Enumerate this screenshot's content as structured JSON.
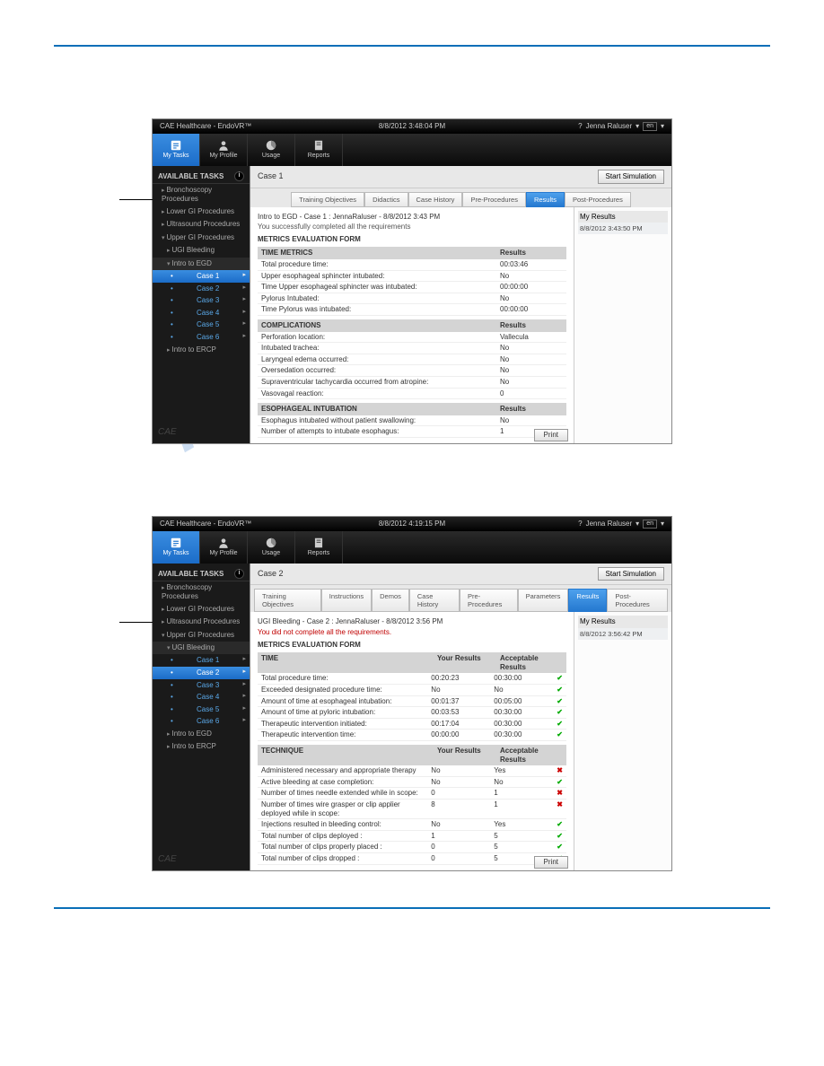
{
  "watermark": "manualshive.com",
  "shot1": {
    "titlebar": {
      "app": "CAE Healthcare - EndoVR™",
      "time": "8/8/2012 3:48:04 PM",
      "user": "Jenna Raluser",
      "lang": "en"
    },
    "toolbar": [
      {
        "label": "My Tasks",
        "active": true
      },
      {
        "label": "My Profile",
        "active": false
      },
      {
        "label": "Usage",
        "active": false
      },
      {
        "label": "Reports",
        "active": false
      }
    ],
    "sidebar": {
      "header": "AVAILABLE TASKS",
      "items": [
        {
          "label": "Bronchoscopy Procedures",
          "type": "cat"
        },
        {
          "label": "Lower GI Procedures",
          "type": "cat"
        },
        {
          "label": "Ultrasound Procedures",
          "type": "cat"
        },
        {
          "label": "Upper GI Procedures",
          "type": "cat-exp"
        },
        {
          "label": "UGI Bleeding",
          "type": "sub-cat"
        },
        {
          "label": "Intro to EGD",
          "type": "sub-cat-exp"
        },
        {
          "label": "Case 1",
          "type": "case",
          "active": true
        },
        {
          "label": "Case 2",
          "type": "case"
        },
        {
          "label": "Case 3",
          "type": "case"
        },
        {
          "label": "Case 4",
          "type": "case"
        },
        {
          "label": "Case 5",
          "type": "case"
        },
        {
          "label": "Case 6",
          "type": "case"
        },
        {
          "label": "Intro to ERCP",
          "type": "sub-cat"
        }
      ]
    },
    "content": {
      "title": "Case 1",
      "startsim": "Start Simulation",
      "tabs": [
        "Training Objectives",
        "Didactics",
        "Case History",
        "Pre-Procedures",
        "Results",
        "Post-Procedures"
      ],
      "active_tab": "Results",
      "case_line": "Intro to EGD - Case 1 : JennaRaluser - 8/8/2012 3:43 PM",
      "status": "You successfully completed all the requirements",
      "status_ok": true,
      "form_title": "METRICS EVALUATION FORM",
      "sections": [
        {
          "head": {
            "title": "TIME METRICS",
            "col2": "Results"
          },
          "rows": [
            [
              "Total procedure time:",
              "00:03:46"
            ],
            [
              "Upper esophageal sphincter intubated:",
              "No"
            ],
            [
              "Time Upper esophageal sphincter was intubated:",
              "00:00:00"
            ],
            [
              "Pylorus Intubated:",
              "No"
            ],
            [
              "Time Pylorus was intubated:",
              "00:00:00"
            ]
          ]
        },
        {
          "head": {
            "title": "COMPLICATIONS",
            "col2": "Results"
          },
          "rows": [
            [
              "Perforation location:",
              "Vallecula"
            ],
            [
              "Intubated trachea:",
              "No"
            ],
            [
              "Laryngeal edema occurred:",
              "No"
            ],
            [
              "Oversedation occurred:",
              "No"
            ],
            [
              "Supraventricular tachycardia occurred from atropine:",
              "No"
            ],
            [
              "Vasovagal reaction:",
              "0"
            ]
          ]
        },
        {
          "head": {
            "title": "ESOPHAGEAL INTUBATION",
            "col2": "Results"
          },
          "rows": [
            [
              "Esophagus intubated without patient swallowing:",
              "No"
            ],
            [
              "Number of attempts to intubate esophagus:",
              "1"
            ]
          ]
        }
      ],
      "print": "Print",
      "rightpanel": {
        "title": "My Results",
        "ts": "8/8/2012 3:43:50 PM"
      }
    }
  },
  "shot2": {
    "titlebar": {
      "app": "CAE Healthcare - EndoVR™",
      "time": "8/8/2012 4:19:15 PM",
      "user": "Jenna Raluser",
      "lang": "en"
    },
    "toolbar": [
      {
        "label": "My Tasks",
        "active": true
      },
      {
        "label": "My Profile",
        "active": false
      },
      {
        "label": "Usage",
        "active": false
      },
      {
        "label": "Reports",
        "active": false
      }
    ],
    "sidebar": {
      "header": "AVAILABLE TASKS",
      "items": [
        {
          "label": "Bronchoscopy Procedures",
          "type": "cat"
        },
        {
          "label": "Lower GI Procedures",
          "type": "cat"
        },
        {
          "label": "Ultrasound Procedures",
          "type": "cat"
        },
        {
          "label": "Upper GI Procedures",
          "type": "cat-exp"
        },
        {
          "label": "UGI Bleeding",
          "type": "sub-cat-exp"
        },
        {
          "label": "Case 1",
          "type": "case"
        },
        {
          "label": "Case 2",
          "type": "case",
          "active": true
        },
        {
          "label": "Case 3",
          "type": "case"
        },
        {
          "label": "Case 4",
          "type": "case"
        },
        {
          "label": "Case 5",
          "type": "case"
        },
        {
          "label": "Case 6",
          "type": "case"
        },
        {
          "label": "Intro to EGD",
          "type": "sub-cat"
        },
        {
          "label": "Intro to ERCP",
          "type": "sub-cat"
        }
      ]
    },
    "content": {
      "title": "Case 2",
      "startsim": "Start Simulation",
      "tabs": [
        "Training Objectives",
        "Instructions",
        "Demos",
        "Case History",
        "Pre-Procedures",
        "Parameters",
        "Results",
        "Post-Procedures"
      ],
      "active_tab": "Results",
      "case_line": "UGI Bleeding - Case 2 : JennaRaluser - 8/8/2012 3:56 PM",
      "status": "You did not complete all the requirements.",
      "status_ok": false,
      "form_title": "METRICS EVALUATION FORM",
      "sections": [
        {
          "head": {
            "title": "TIME",
            "col2": "Your Results",
            "col3": "Acceptable Results"
          },
          "rows": [
            [
              "Total procedure time:",
              "00:20:23",
              "00:30:00",
              "ok"
            ],
            [
              "Exceeded designated procedure time:",
              "No",
              "No",
              "ok"
            ],
            [
              "Amount of time at esophageal intubation:",
              "00:01:37",
              "00:05:00",
              "ok"
            ],
            [
              "Amount of time at pyloric intubation:",
              "00:03:53",
              "00:30:00",
              "ok"
            ],
            [
              "Therapeutic intervention initiated:",
              "00:17:04",
              "00:30:00",
              "ok"
            ],
            [
              "Therapeutic intervention time:",
              "00:00:00",
              "00:30:00",
              "ok"
            ]
          ]
        },
        {
          "head": {
            "title": "TECHNIQUE",
            "col2": "Your Results",
            "col3": "Acceptable Results"
          },
          "rows": [
            [
              "Administered necessary and appropriate therapy",
              "No",
              "Yes",
              "bad"
            ],
            [
              "Active bleeding at case completion:",
              "No",
              "No",
              "ok"
            ],
            [
              "Number of times needle extended while in scope:",
              "0",
              "1",
              "bad"
            ],
            [
              "Number of times wire grasper or clip applier deployed while in scope:",
              "8",
              "1",
              "bad"
            ],
            [
              "Injections resulted in bleeding control:",
              "No",
              "Yes",
              "ok"
            ],
            [
              "Total number of clips deployed :",
              "1",
              "5",
              "ok"
            ],
            [
              "Total number of clips properly placed :",
              "0",
              "5",
              "ok"
            ],
            [
              "Total number of clips dropped :",
              "0",
              "5",
              "ok"
            ]
          ]
        }
      ],
      "print": "Print",
      "rightpanel": {
        "title": "My Results",
        "ts": "8/8/2012 3:56:42 PM"
      }
    }
  }
}
